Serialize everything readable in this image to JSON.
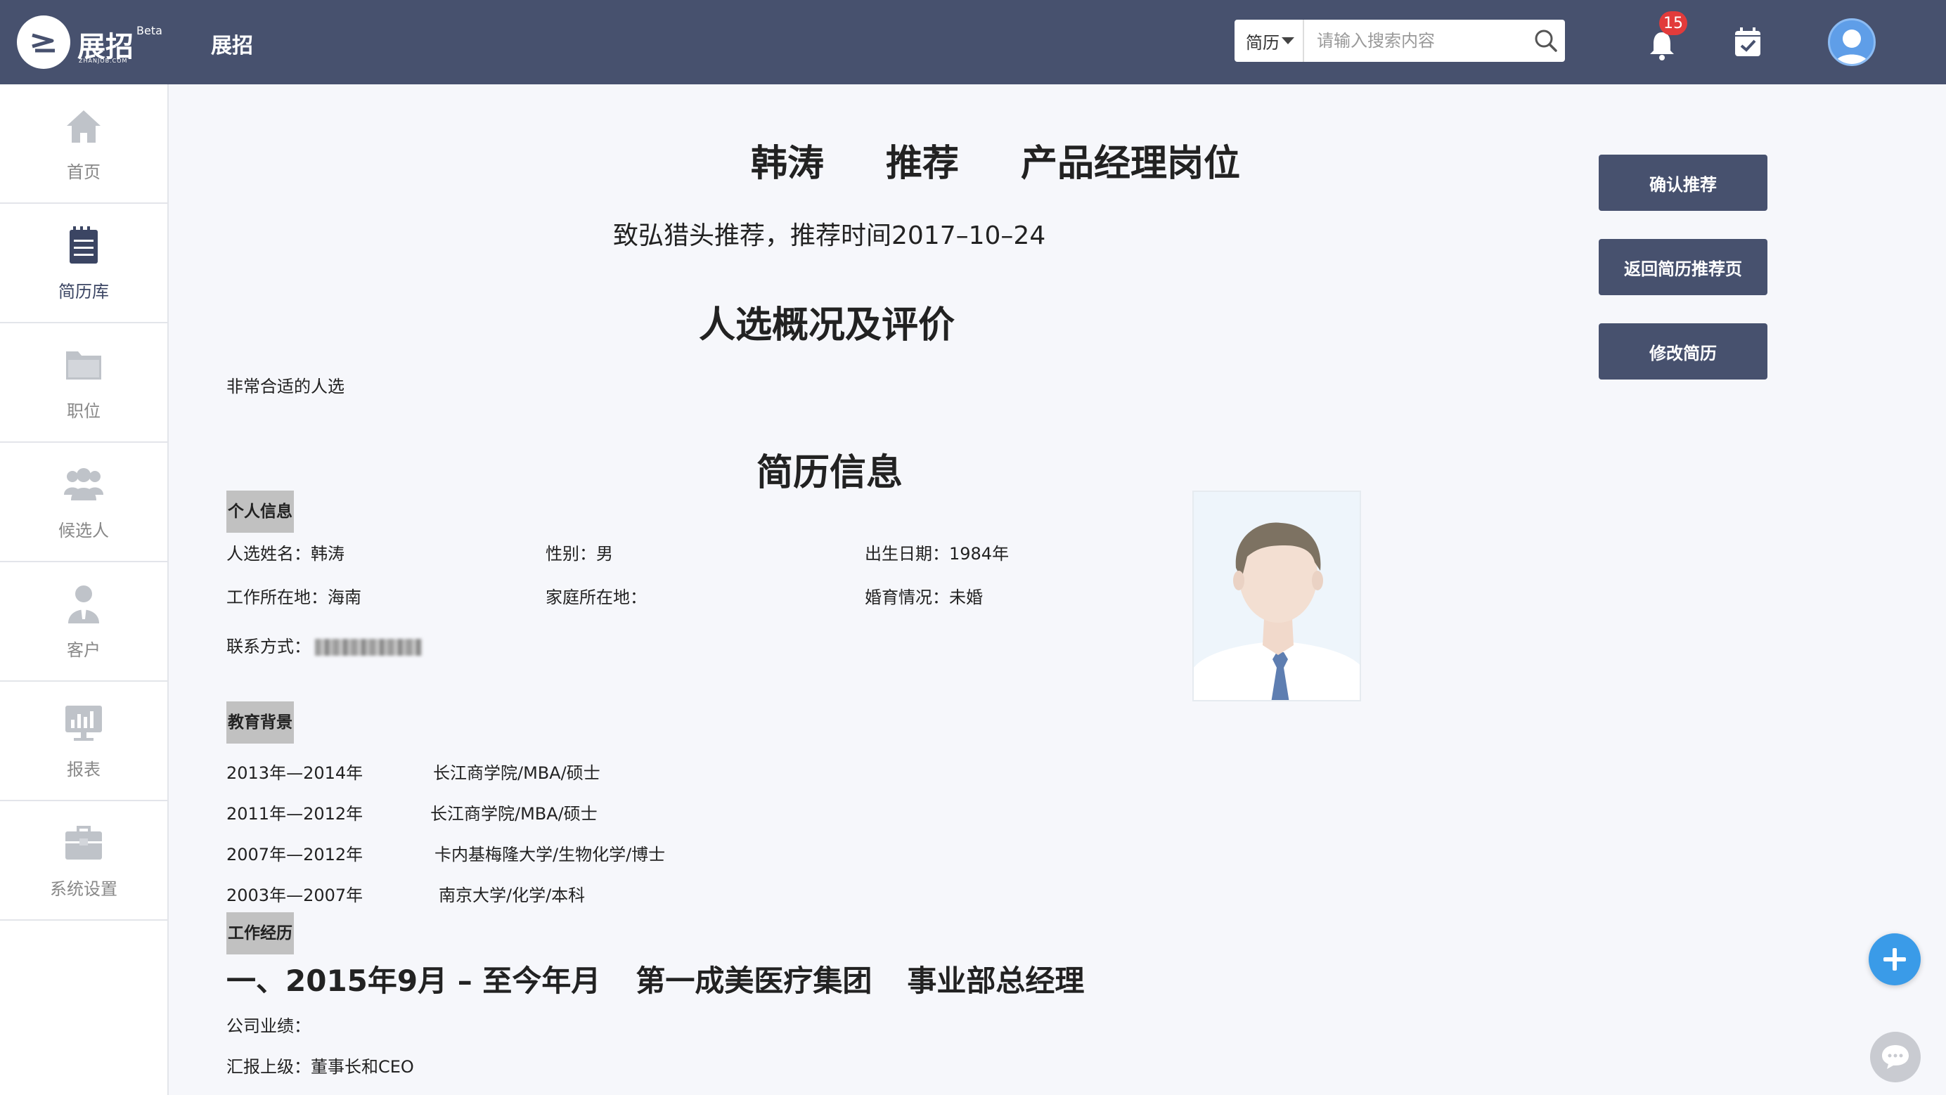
{
  "header": {
    "logo_text": "展招",
    "logo_beta": "Beta",
    "logo_sub": "ZHANJOB.COM",
    "app_title": "展招",
    "search": {
      "type": "简历",
      "placeholder": "请输入搜索内容"
    },
    "notifications_count": "15"
  },
  "sidebar": {
    "items": [
      {
        "label": "首页",
        "icon": "home-icon"
      },
      {
        "label": "简历库",
        "icon": "resume-library-icon",
        "active": true
      },
      {
        "label": "职位",
        "icon": "folder-icon"
      },
      {
        "label": "候选人",
        "icon": "people-icon"
      },
      {
        "label": "客户",
        "icon": "customer-icon"
      },
      {
        "label": "报表",
        "icon": "report-icon"
      },
      {
        "label": "系统设置",
        "icon": "toolbox-icon"
      }
    ]
  },
  "recommendation": {
    "candidate": "韩涛",
    "action": "推荐",
    "position": "产品经理岗位",
    "subline": "致弘猎头推荐，推荐时间2017–10–24"
  },
  "evaluation": {
    "title": "人选概况及评价",
    "text": "非常合适的人选"
  },
  "resume": {
    "title": "简历信息",
    "personal_tag": "个人信息",
    "name_label": "人选姓名：",
    "name": "韩涛",
    "gender_label": "性别：",
    "gender": "男",
    "birth_label": "出生日期：",
    "birth": "1984年",
    "work_loc_label": "工作所在地：",
    "work_loc": "海南",
    "home_loc_label": "家庭所在地：",
    "home_loc": "",
    "marital_label": "婚育情况：",
    "marital": "未婚",
    "contact_label": "联系方式："
  },
  "education": {
    "tag": "教育背景",
    "rows": [
      {
        "years": "2013年—2014年",
        "school": "长江商学院/MBA/硕士"
      },
      {
        "years": "2011年—2012年",
        "school": "长江商学院/MBA/硕士"
      },
      {
        "years": "2007年—2012年",
        "school": "卡内基梅隆大学/生物化学/博士"
      },
      {
        "years": "2003年—2007年",
        "school": "南京大学/化学/本科"
      }
    ]
  },
  "work": {
    "tag": "工作经历",
    "entry_index": "一、2015年9月 – 至今年月",
    "company": "第一成美医疗集团",
    "role": "事业部总经理",
    "perf_label": "公司业绩：",
    "report_label": "汇报上级：",
    "report_to": "董事长和CEO"
  },
  "actions": {
    "confirm": "确认推荐",
    "back": "返回简历推荐页",
    "edit": "修改简历"
  },
  "colors": {
    "nav_bg": "#47516e",
    "button_bg": "#47516e",
    "badge": "#e23b3b",
    "fab": "#3a9be8"
  }
}
